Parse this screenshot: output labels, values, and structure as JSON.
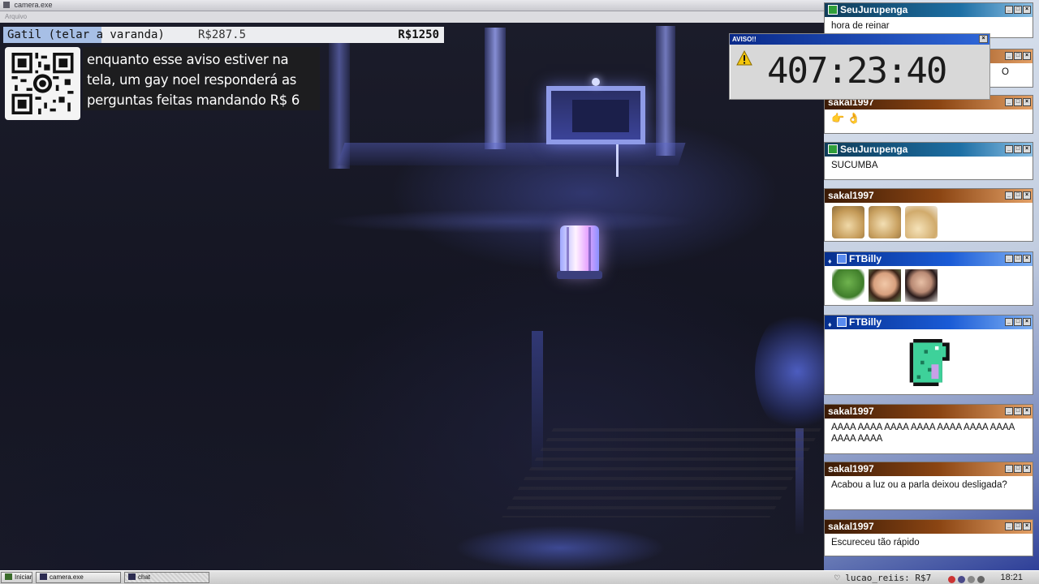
{
  "camera_window": {
    "title": "camera.exe",
    "menu": "Arquivo"
  },
  "overlay": {
    "stream_title": "Gatil (telar a varanda)",
    "money_current": "R$287.5",
    "money_goal": "R$1250",
    "notice_lines": [
      "enquanto esse aviso estiver na",
      "tela, um gay noel responderá as",
      "perguntas feitas mandando R$ 6"
    ]
  },
  "aviso": {
    "title": "AVISO!!",
    "timer": "407:23:40"
  },
  "chat": {
    "messages": [
      {
        "user": "SeuJurupenga",
        "text": "hora de reinar",
        "badge": "pencil-icon",
        "color": "green"
      },
      {
        "user": "",
        "text": "O",
        "badge": "",
        "color": "orange"
      },
      {
        "user": "sakal1997",
        "text": "👉 👌",
        "badge": "",
        "color": "orange"
      },
      {
        "user": "SeuJurupenga",
        "text": "SUCUMBA",
        "badge": "pencil-icon",
        "color": "green"
      },
      {
        "user": "sakal1997",
        "text": "",
        "badge": "",
        "color": "orange",
        "emotes": [
          "doge-emote",
          "doge-emote",
          "doge-emote"
        ]
      },
      {
        "user": "FTBilly",
        "text": "",
        "badge": "crown-icon",
        "color": "blue",
        "emotes": [
          "pepe-emote",
          "woman-photo-emote",
          "woman-photo-emote"
        ]
      },
      {
        "user": "FTBilly",
        "text": "",
        "badge": "crown-icon",
        "color": "blue",
        "emotes": [
          "pixel-dinosaur-emote"
        ]
      },
      {
        "user": "sakal1997",
        "text": "AAAA AAAA AAAA AAAA AAAA AAAA AAAA AAAA AAAA",
        "badge": "",
        "color": "orange"
      },
      {
        "user": "sakal1997",
        "text": "Acabou a luz ou a parla deixou desligada?",
        "badge": "",
        "color": "orange"
      },
      {
        "user": "sakal1997",
        "text": "Escureceu tão rápido",
        "badge": "",
        "color": "orange"
      }
    ]
  },
  "taskbar": {
    "start": "Iniciar",
    "tasks": [
      "camera.exe",
      "chat"
    ],
    "tray_user": "♡ lucao_reiis: R$7",
    "clock": "18:21"
  },
  "colors": {
    "chat_green": "#1d6fa4",
    "chat_orange": "#8b4513",
    "chat_blue": "#1a5bd6",
    "aviso_title": "#0a2a8a",
    "overlay_highlight": "#a7bfe6"
  }
}
